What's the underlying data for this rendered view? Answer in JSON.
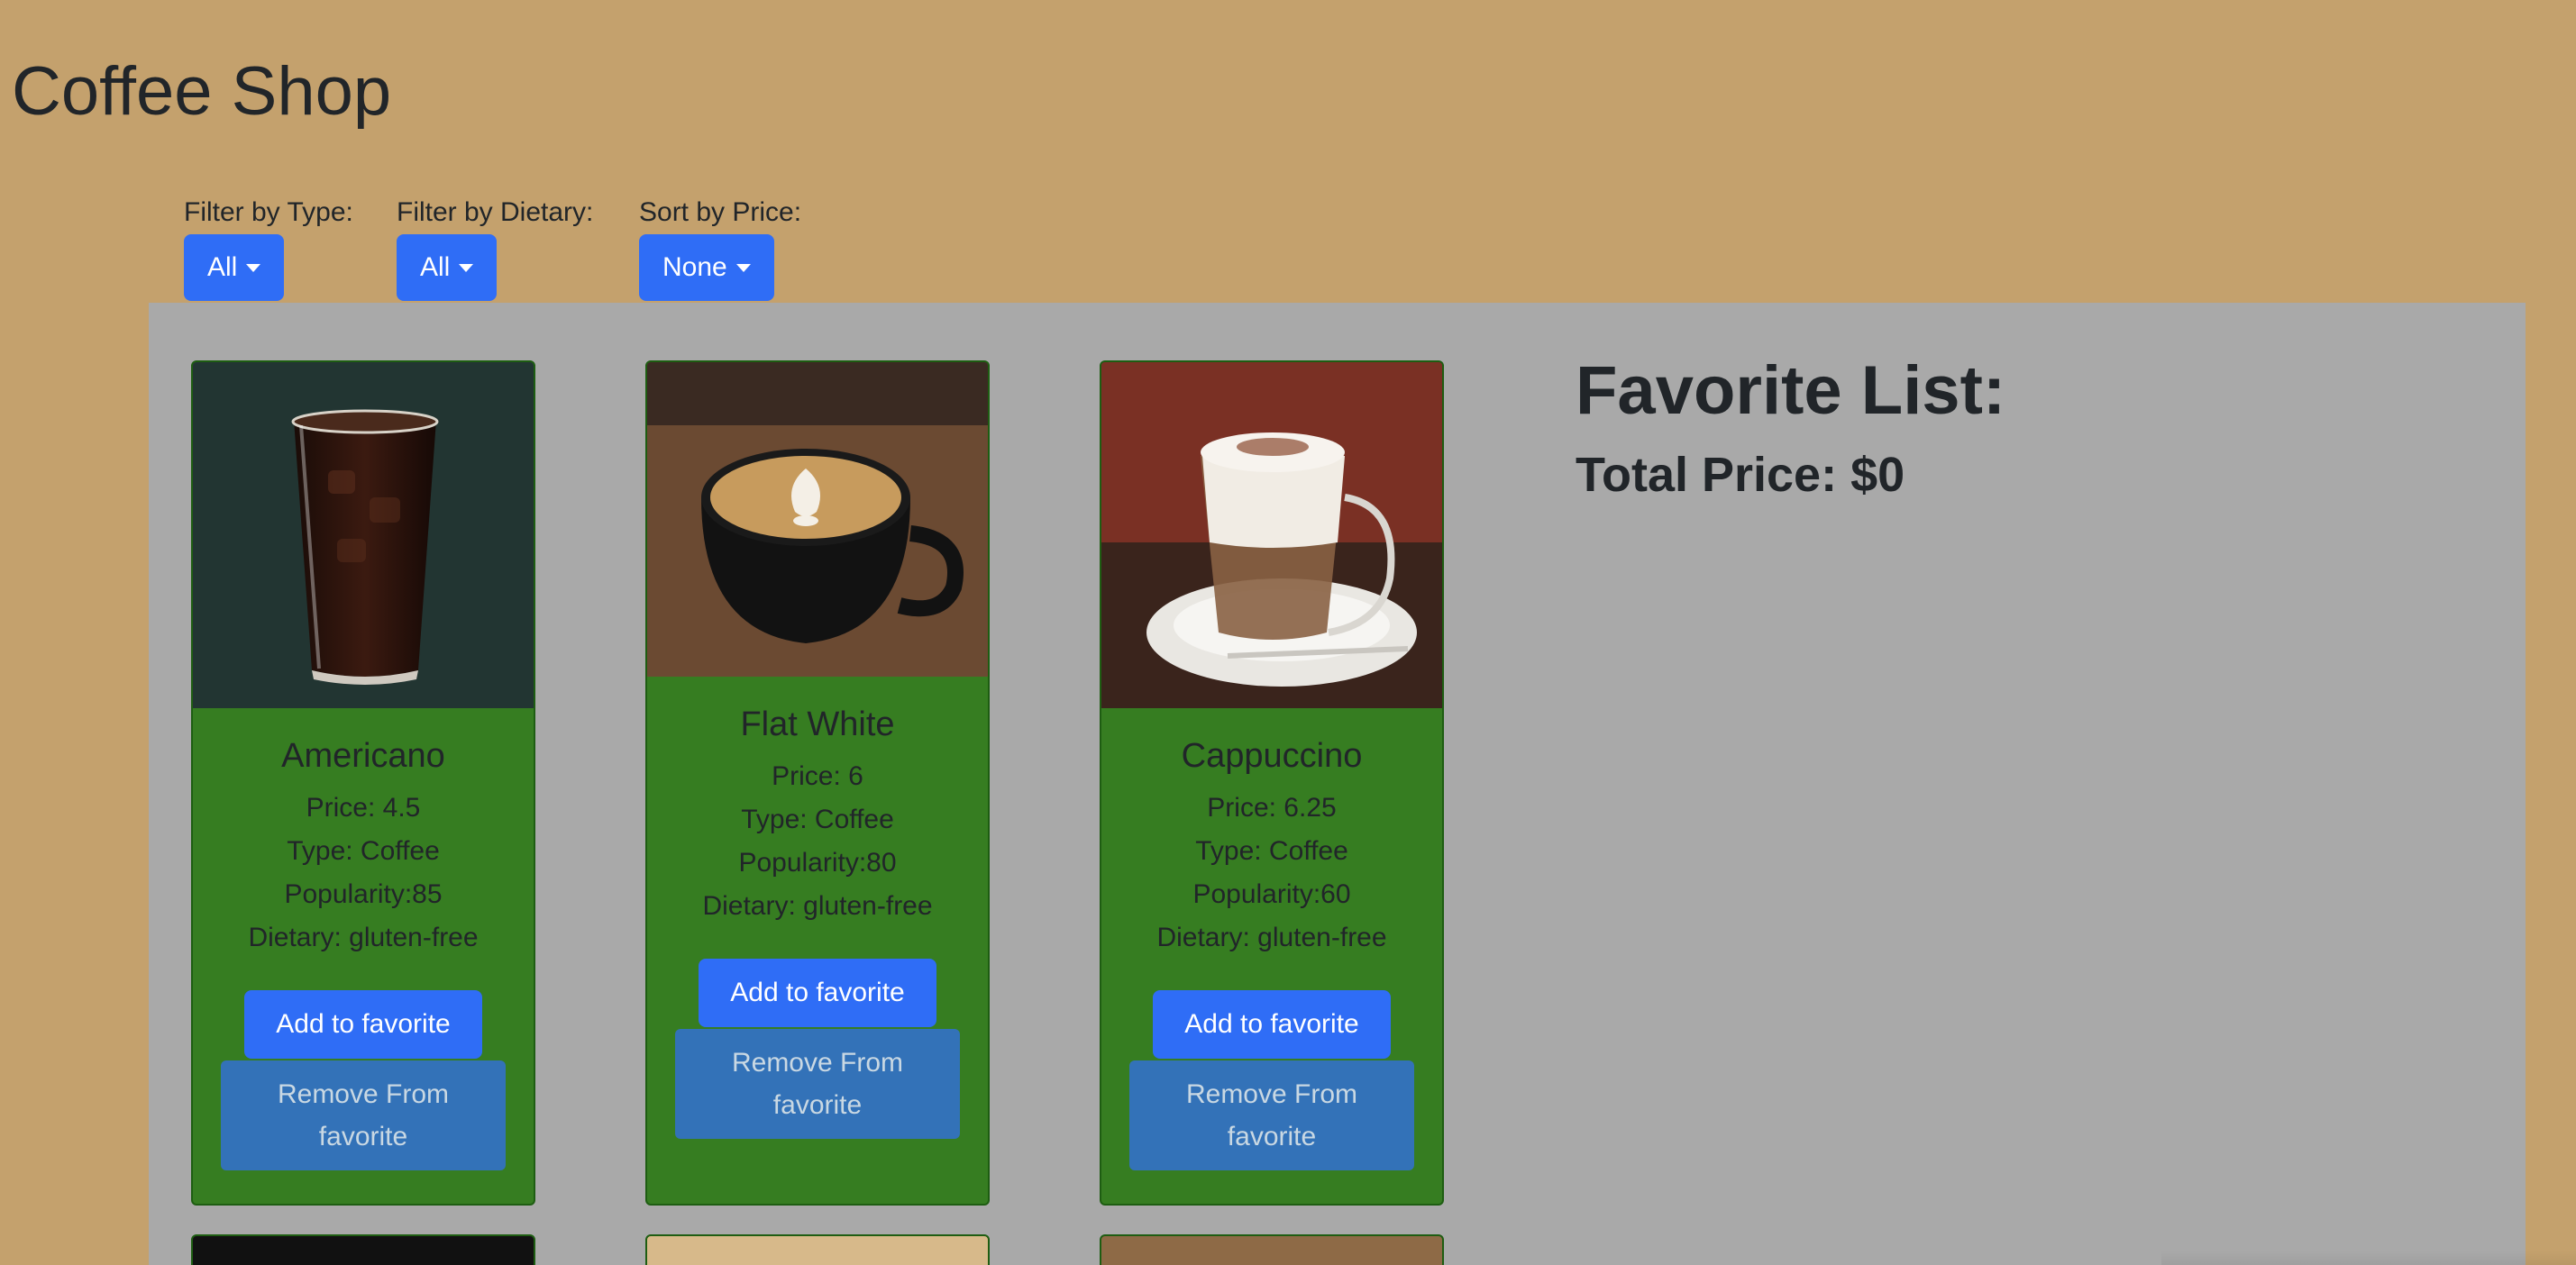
{
  "app": {
    "title": "Coffee Shop"
  },
  "filters": [
    {
      "label": "Filter by Type:",
      "value": "All"
    },
    {
      "label": "Filter by Dietary:",
      "value": "All"
    },
    {
      "label": "Sort by Price:",
      "value": "None"
    }
  ],
  "products": [
    {
      "name": "Americano",
      "price": "Price: 4.5",
      "type": "Type: Coffee",
      "popularity": "Popularity:85",
      "dietary": "Dietary: gluten-free",
      "add_label": "Add to favorite",
      "remove_label_1": "Remove From",
      "remove_label_2": "favorite",
      "image": "iced-americano-photo"
    },
    {
      "name": "Flat White",
      "price": "Price: 6",
      "type": "Type: Coffee",
      "popularity": "Popularity:80",
      "dietary": "Dietary: gluten-free",
      "add_label": "Add to favorite",
      "remove_label_1": "Remove From",
      "remove_label_2": "favorite",
      "image": "flat-white-latte-art-photo"
    },
    {
      "name": "Cappuccino",
      "price": "Price: 6.25",
      "type": "Type: Coffee",
      "popularity": "Popularity:60",
      "dietary": "Dietary: gluten-free",
      "add_label": "Add to favorite",
      "remove_label_1": "Remove From",
      "remove_label_2": "favorite",
      "image": "cappuccino-glass-photo"
    }
  ],
  "favorites": {
    "title": "Favorite List:",
    "total": "Total Price: $0"
  },
  "colors": {
    "page_bg": "#c4a16d",
    "panel_bg": "#a9a9a9",
    "card_bg": "#367d21",
    "primary": "#2f6df6",
    "remove_btn": "#3372b8"
  }
}
